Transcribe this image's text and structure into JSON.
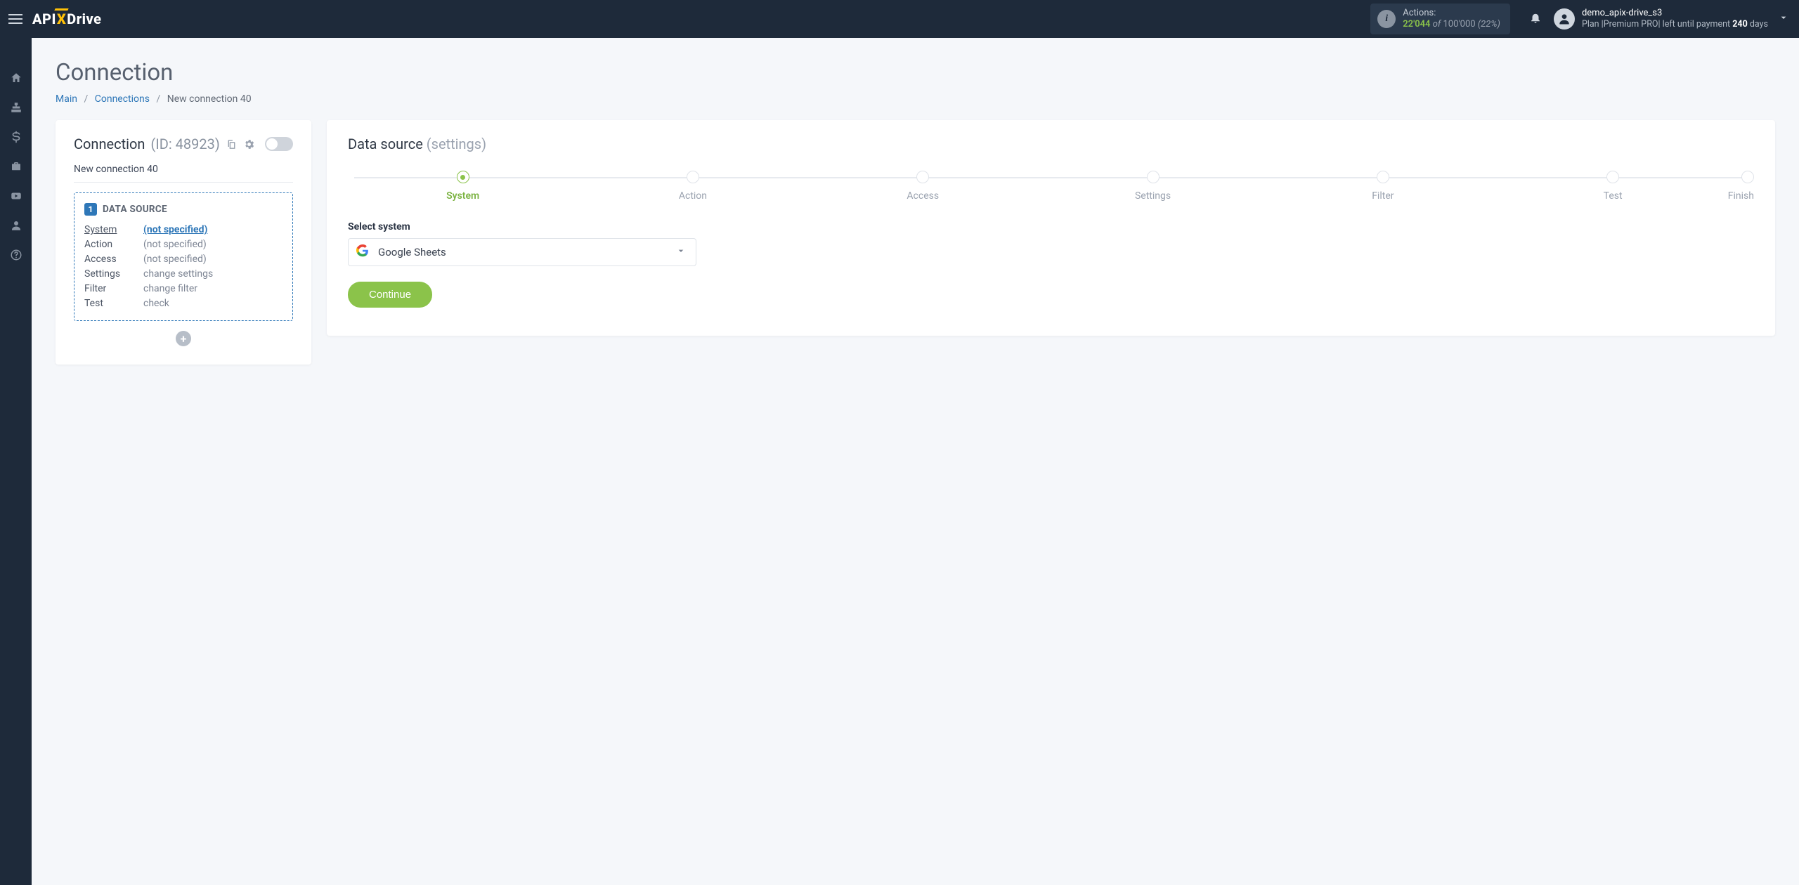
{
  "header": {
    "actions_label": "Actions:",
    "actions_count": "22'044",
    "actions_of": " of ",
    "actions_total": "100'000",
    "actions_pct": "(22%)",
    "username": "demo_apix-drive_s3",
    "plan_prefix": "Plan |",
    "plan_name": "Premium PRO",
    "plan_middle": "| left until payment ",
    "plan_days": "240",
    "plan_suffix": " days",
    "logo_a": "API",
    "logo_b": "X",
    "logo_c": "Drive"
  },
  "page": {
    "title": "Connection",
    "bc_main": "Main",
    "bc_connections": "Connections",
    "bc_current": "New connection 40"
  },
  "left": {
    "title": "Connection",
    "id_label": "(ID: 48923)",
    "subtitle": "New connection 40",
    "ds_badge": "1",
    "ds_title": "DATA SOURCE",
    "rows": {
      "system_k": "System",
      "system_v": "(not specified)",
      "action_k": "Action",
      "action_v": "(not specified)",
      "access_k": "Access",
      "access_v": "(not specified)",
      "settings_k": "Settings",
      "settings_v": "change settings",
      "filter_k": "Filter",
      "filter_v": "change filter",
      "test_k": "Test",
      "test_v": "check"
    }
  },
  "right": {
    "title": "Data source",
    "title_sub": "(settings)",
    "steps": {
      "s1": "System",
      "s2": "Action",
      "s3": "Access",
      "s4": "Settings",
      "s5": "Filter",
      "s6": "Test",
      "s7": "Finish"
    },
    "select_label": "Select system",
    "select_value": "Google Sheets",
    "continue": "Continue"
  }
}
